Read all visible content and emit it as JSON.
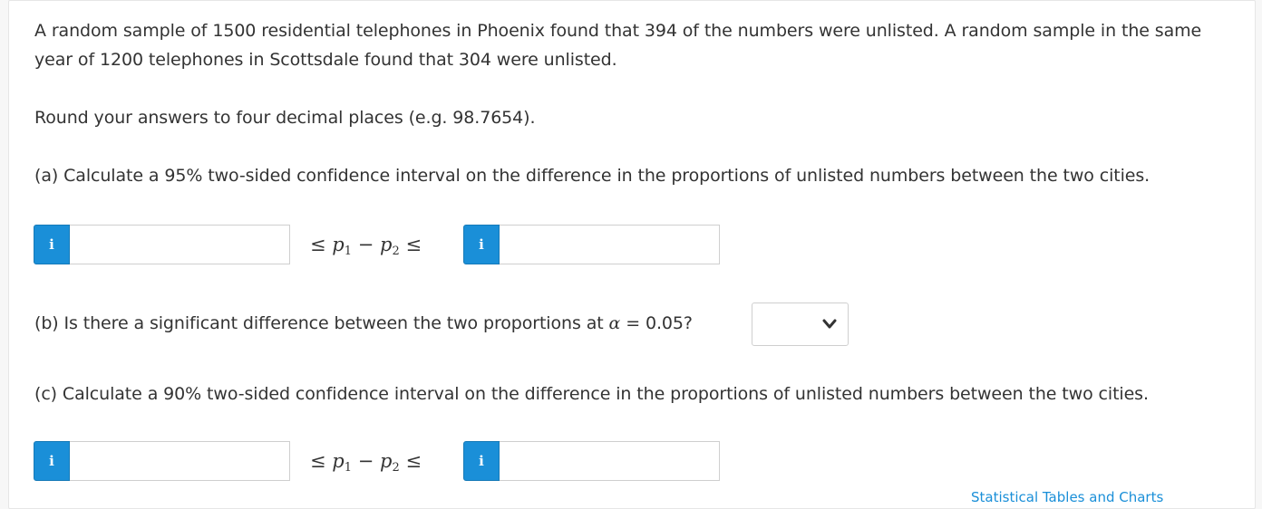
{
  "question": {
    "intro": "A random sample of 1500 residential telephones in Phoenix found that 394 of the numbers were unlisted. A random sample in the same year of 1200 telephones in Scottsdale found that 304 were unlisted.",
    "rounding_note": "Round your answers to four decimal places (e.g. 98.7654).",
    "part_a": "(a) Calculate a 95% two-sided confidence interval on the difference in the proportions of unlisted numbers between the two cities.",
    "part_b_prefix": "(b) Is there a significant difference between the two proportions at ",
    "part_b_alpha": "α",
    "part_b_suffix": " = 0.05?",
    "part_c": "(c) Calculate a 90% two-sided confidence interval on the difference in the proportions of unlisted numbers between the two cities."
  },
  "inequality": {
    "leq": "≤",
    "p": "p",
    "sub1": "1",
    "sub2": "2",
    "minus": "−"
  },
  "info_button": {
    "label": "i"
  },
  "inputs": {
    "a_lower": {
      "value": ""
    },
    "a_upper": {
      "value": ""
    },
    "c_lower": {
      "value": ""
    },
    "c_upper": {
      "value": ""
    }
  },
  "select_b": {
    "selected": ""
  },
  "footer_link": {
    "label": "Statistical Tables and Charts"
  },
  "colors": {
    "accent": "#1a8fd8",
    "text": "#333333",
    "border": "#cfcfcf"
  },
  "icons": [
    "info-icon",
    "chevron-down-icon"
  ]
}
